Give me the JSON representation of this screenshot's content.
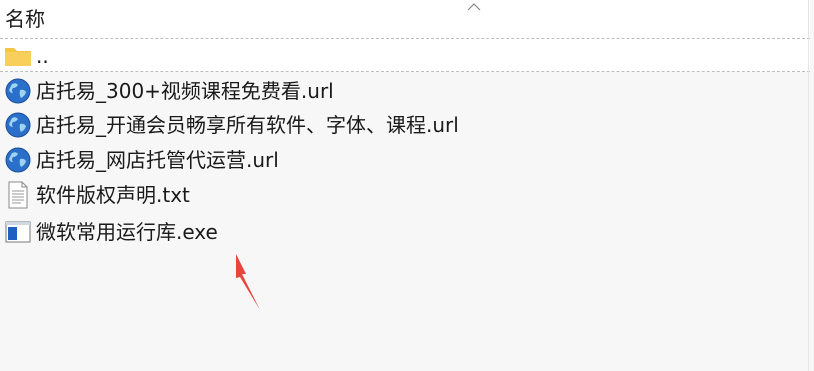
{
  "header": {
    "column_name_label": "名称"
  },
  "rows": [
    {
      "name": "..",
      "icon": "folder-icon"
    },
    {
      "name": "店托易_300+视频课程免费看.url",
      "icon": "globe-icon"
    },
    {
      "name": "店托易_开通会员畅享所有软件、字体、课程.url",
      "icon": "globe-icon"
    },
    {
      "name": "店托易_网店托管代运营.url",
      "icon": "globe-icon"
    },
    {
      "name": "软件版权声明.txt",
      "icon": "text-file-icon"
    },
    {
      "name": "微软常用运行库.exe",
      "icon": "exe-app-icon"
    }
  ],
  "colors": {
    "annotation_arrow": "#e8453c",
    "folder": "#f6c443",
    "globe": "#2a6fc9"
  }
}
